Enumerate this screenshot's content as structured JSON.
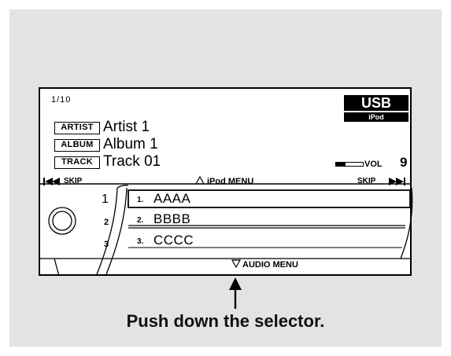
{
  "display": {
    "track_counter": "1/10",
    "source": "USB",
    "sub_source": "iPod",
    "artist_label": "ARTIST",
    "artist": "Artist 1",
    "album_label": "ALBUM",
    "album": "Album 1",
    "track_label": "TRACK",
    "track": "Track 01",
    "volume_label": "VOL",
    "volume_value": "9",
    "volume_level": 0.35
  },
  "controls": {
    "skip_back": "SKIP",
    "skip_forward": "SKIP",
    "ipod_menu": "iPod MENU",
    "audio_menu": "AUDIO MENU"
  },
  "presets": [
    "1",
    "2",
    "3"
  ],
  "menu_items": [
    {
      "number": "1.",
      "label": "AAAA"
    },
    {
      "number": "2.",
      "label": "BBBB"
    },
    {
      "number": "3.",
      "label": "CCCC"
    }
  ],
  "caption": "Push down the selector.",
  "colors": {
    "panel_background": "#e3e3e3",
    "display_background": "#ffffff",
    "ink": "#000000"
  },
  "icons": {
    "skip_back": "skip-back-icon",
    "skip_forward": "skip-forward-icon",
    "menu_up": "triangle-up-icon",
    "menu_down": "triangle-down-icon",
    "knob": "selector-knob-icon",
    "arrow": "push-arrow-icon"
  }
}
